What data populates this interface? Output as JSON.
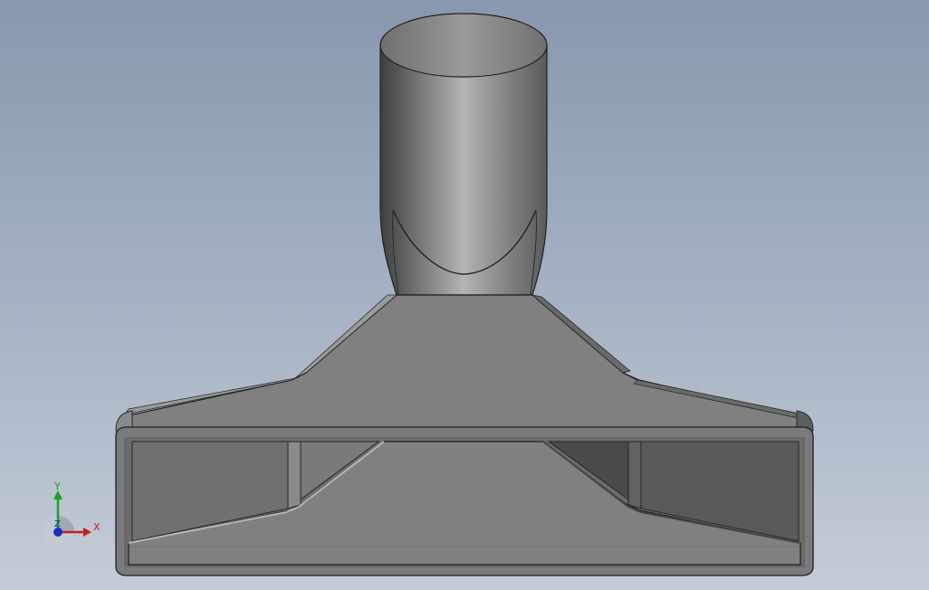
{
  "viewport": {
    "background_top": "#8797ad",
    "background_bottom": "#c4ccd6"
  },
  "model": {
    "shape": "vacuum-floor-nozzle",
    "color": "#7f7f7f"
  },
  "triad": {
    "x_label": "X",
    "y_label": "Y",
    "z_label": "Z",
    "x_color": "#c42020",
    "y_color": "#1f9e2a",
    "z_color": "#1a2fbf"
  }
}
